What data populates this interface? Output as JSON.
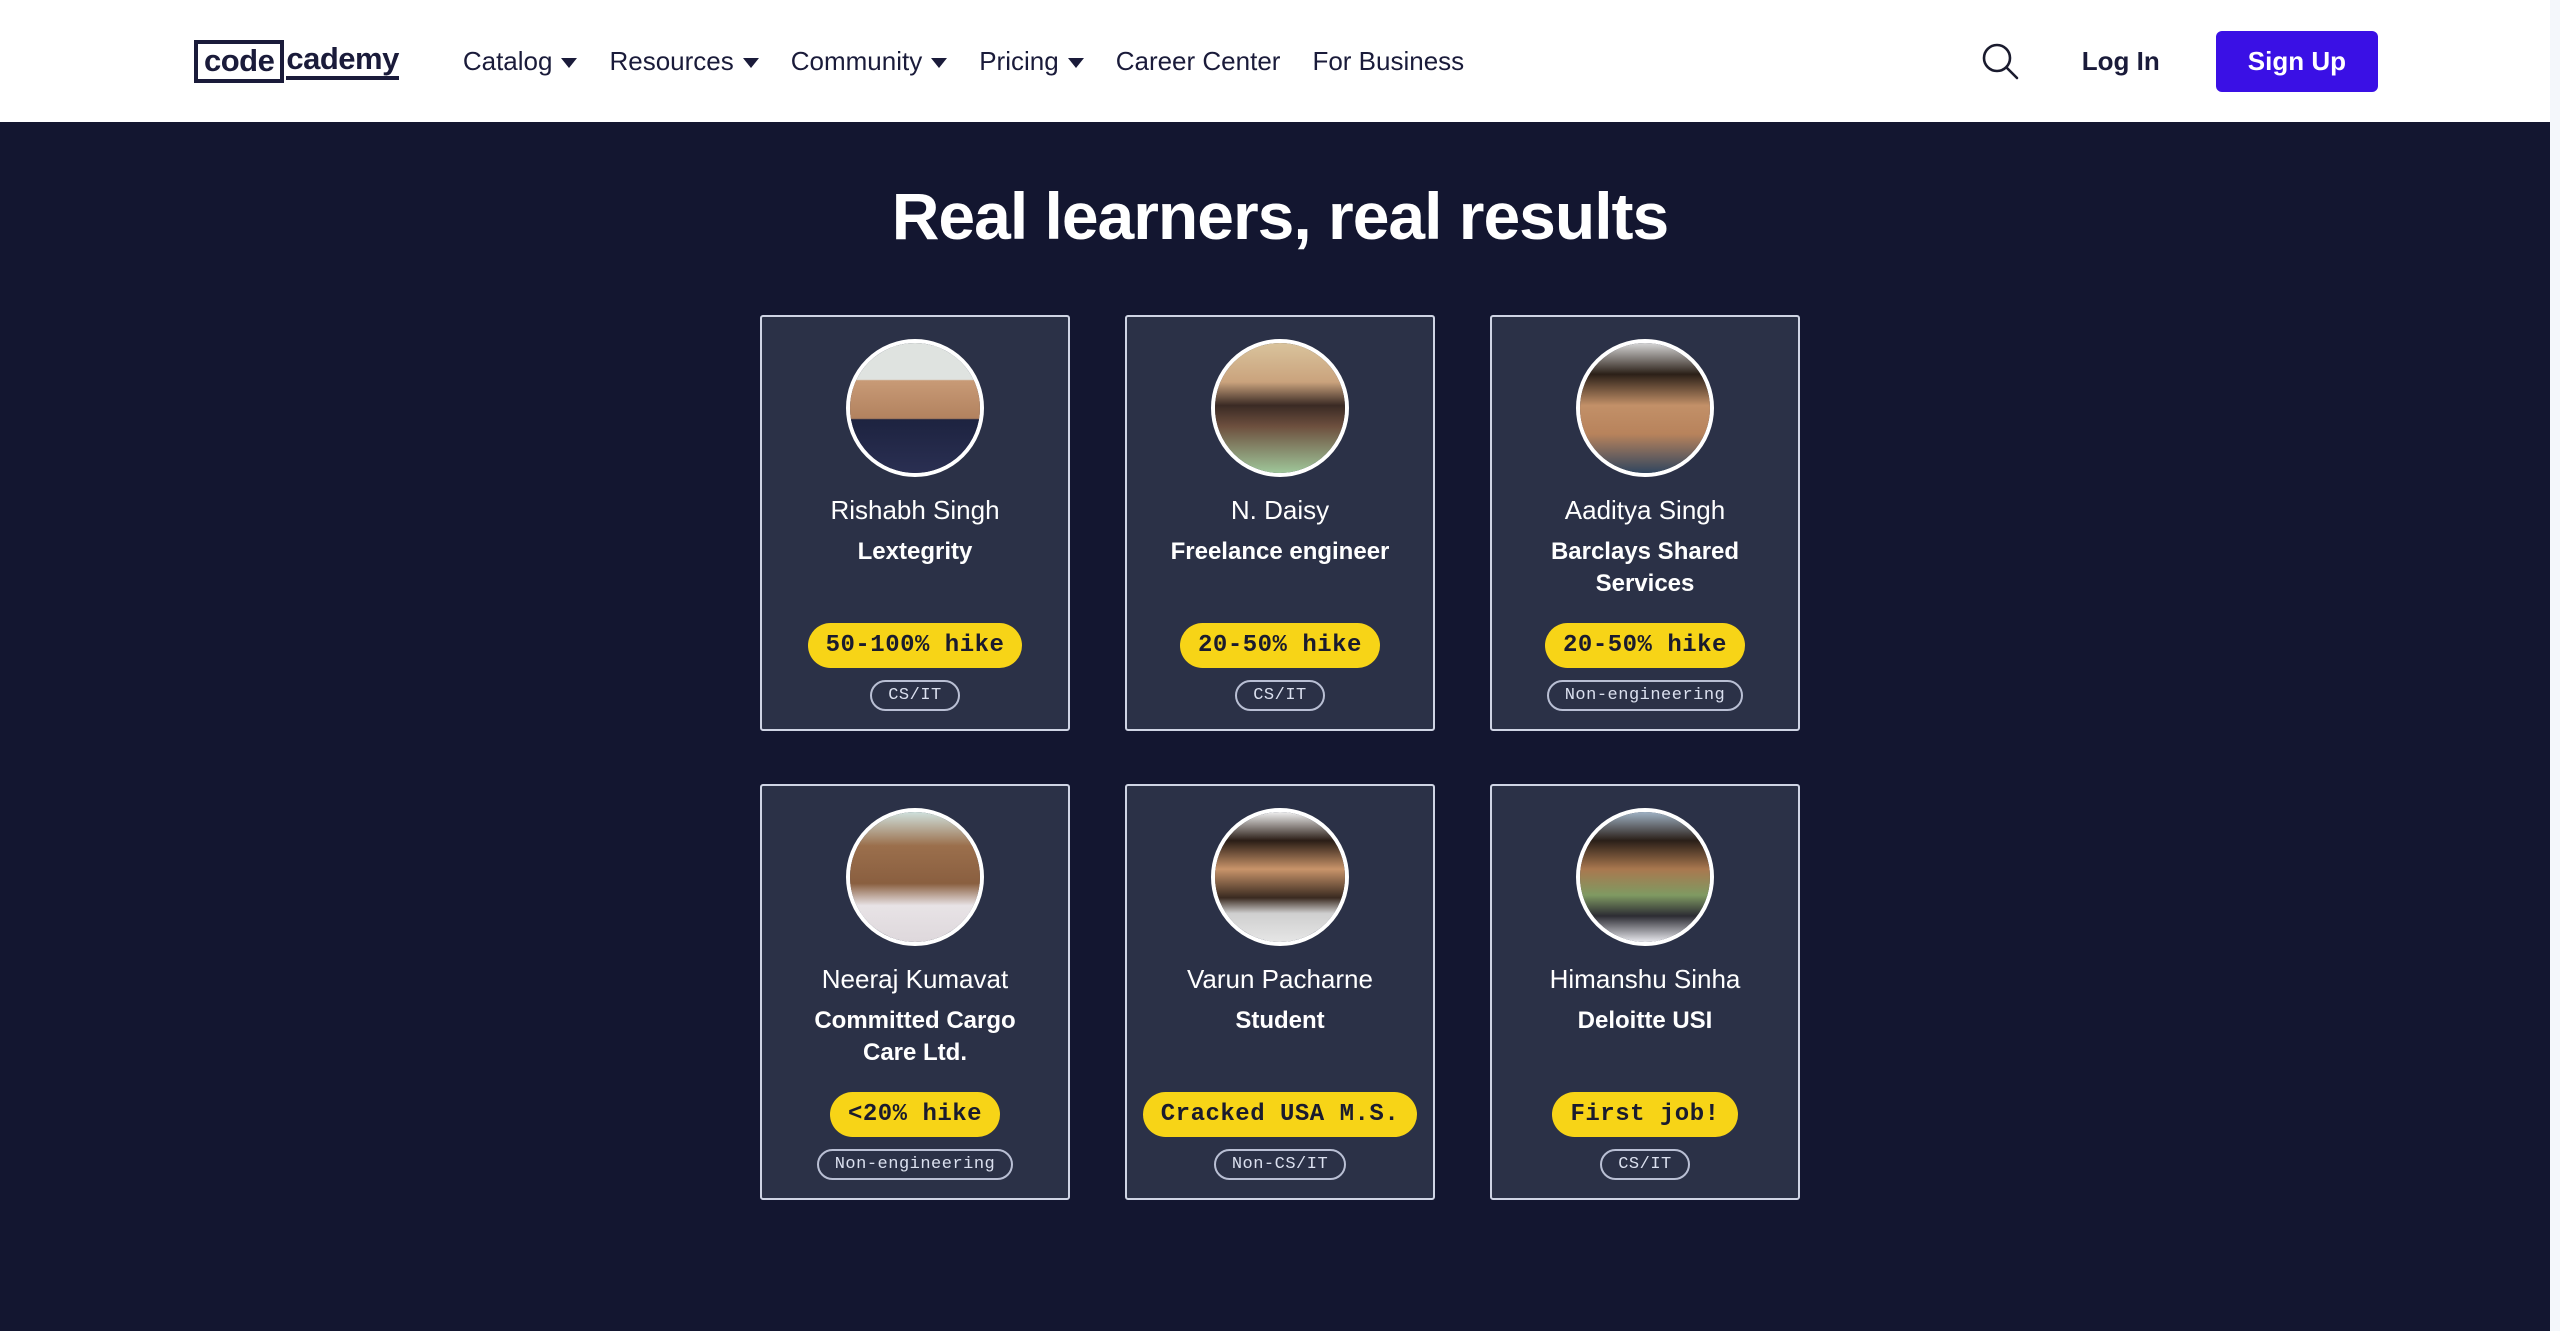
{
  "navbar": {
    "logo": {
      "boxed_text": "code",
      "rest_text": "cademy"
    },
    "links": [
      {
        "label": "Catalog",
        "has_dropdown": true
      },
      {
        "label": "Resources",
        "has_dropdown": true
      },
      {
        "label": "Community",
        "has_dropdown": true
      },
      {
        "label": "Pricing",
        "has_dropdown": true
      },
      {
        "label": "Career Center",
        "has_dropdown": false
      },
      {
        "label": "For Business",
        "has_dropdown": false
      }
    ],
    "search_icon": "search-icon",
    "login_label": "Log In",
    "signup_label": "Sign Up"
  },
  "main": {
    "title": "Real learners, real results"
  },
  "cards": [
    {
      "name": "Rishabh Singh",
      "company": "Lextegrity",
      "hike": "50-100% hike",
      "tag": "CS/IT",
      "avatar": "avatar-rishabh-singh",
      "photo_class": "ph-skin-a"
    },
    {
      "name": "N. Daisy",
      "company": "Freelance engineer",
      "hike": "20-50% hike",
      "tag": "CS/IT",
      "avatar": "avatar-n-daisy",
      "photo_class": "ph-skin-b"
    },
    {
      "name": "Aaditya Singh",
      "company": "Barclays Shared Services",
      "hike": "20-50% hike",
      "tag": "Non-engineering",
      "avatar": "avatar-aaditya-singh",
      "photo_class": "ph-skin-c"
    },
    {
      "name": "Neeraj Kumavat",
      "company": "Committed Cargo Care Ltd.",
      "hike": "<20% hike",
      "tag": "Non-engineering",
      "avatar": "avatar-neeraj-kumavat",
      "photo_class": "ph-skin-d"
    },
    {
      "name": "Varun Pacharne",
      "company": "Student",
      "hike": "Cracked USA M.S.",
      "tag": "Non-CS/IT",
      "avatar": "avatar-varun-pacharne",
      "photo_class": "ph-skin-e"
    },
    {
      "name": "Himanshu Sinha",
      "company": "Deloitte USI",
      "hike": "First job!",
      "tag": "CS/IT",
      "avatar": "avatar-himanshu-sinha",
      "photo_class": "ph-skin-f"
    }
  ],
  "colors": {
    "page_background": "#131630",
    "navbar_background": "#ffffff",
    "card_background": "#2b3147",
    "card_border": "#cfd4e4",
    "brand_purple": "#3a10e5",
    "badge_yellow": "#f7d417",
    "text_light": "#ffffff",
    "text_dark": "#1a1b3a"
  }
}
